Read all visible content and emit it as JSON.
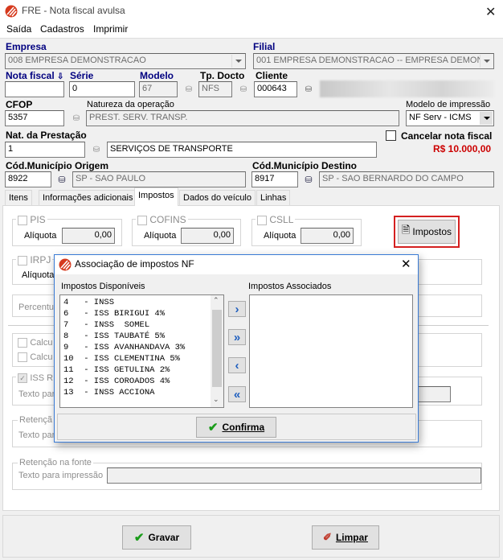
{
  "window": {
    "title": "FRE - Nota fiscal avulsa"
  },
  "menu": [
    "Saída",
    "Cadastros",
    "Imprimir"
  ],
  "form": {
    "empresa_label": "Empresa",
    "empresa_value": "008 EMPRESA DEMONSTRACAO",
    "filial_label": "Filial",
    "filial_value": "001 EMPRESA DEMONSTRACAO -- EMPRESA DEMONS",
    "nota_label": "Nota fiscal",
    "nota_value": "",
    "serie_label": "Série",
    "serie_value": "0",
    "modelo_label": "Modelo",
    "modelo_value": "67",
    "tpdocto_label": "Tp. Docto",
    "tpdocto_value": "NFS",
    "cliente_label": "Cliente",
    "cliente_value": "000643",
    "cfop_label": "CFOP",
    "cfop_value": "5357",
    "natureza_label": "Natureza da operação",
    "natureza_value": "PREST. SERV. TRANSP.",
    "modelo_imp_label": "Modelo de impressão",
    "modelo_imp_value": "NF Serv - ICMS",
    "natprest_label": "Nat. da Prestação",
    "natprest_code": "1",
    "natprest_desc": "SERVIÇOS DE TRANSPORTE",
    "cancelar_label": "Cancelar nota fiscal",
    "valor_total": "R$ 10.000,00",
    "origem_label": "Cód.Município Origem",
    "origem_code": "8922",
    "origem_desc": "SP - SAO PAULO",
    "destino_label": "Cód.Município Destino",
    "destino_code": "8917",
    "destino_desc": "SP - SAO BERNARDO DO CAMPO"
  },
  "tabs": [
    "Itens",
    "Informações adicionais",
    "Impostos",
    "Dados do veículo",
    "Linhas"
  ],
  "impostos": {
    "pis": "PIS",
    "cofins": "COFINS",
    "csll": "CSLL",
    "aliquota": "Alíquota",
    "zero": "0,00",
    "impostos_button": "Impostos",
    "irpj": "IRPJ",
    "aliquota_short": "Alíquota",
    "percentual": "Percentu",
    "calc1": "Calcu",
    "calc2": "Calcu",
    "iss": "ISS R",
    "texto1": "Texto par",
    "retencao1": "Retençã",
    "texto2": "Texto par",
    "retencao_fonte": "Retenção na fonte",
    "texto_impressao": "Texto para impressão"
  },
  "dialog": {
    "title": "Associação de impostos NF",
    "disponiveis_label": "Impostos Disponíveis",
    "associados_label": "Impostos Associados",
    "items": [
      "4   - INSS",
      "6   - ISS BIRIGUI 4%",
      "7   - INSS  SOMEL",
      "8   - ISS TAUBATÉ 5%",
      "9   - ISS AVANHANDAVA 3%",
      "10  - ISS CLEMENTINA 5%",
      "11  - ISS GETULINA 2%",
      "12  - ISS COROADOS 4%",
      "13  - INSS ACCIONA"
    ],
    "btn_add": "›",
    "btn_add_all": "»",
    "btn_remove": "‹",
    "btn_remove_all": "«",
    "confirma": "Confirma"
  },
  "footer": {
    "gravar": "Gravar",
    "limpar": "Limpar"
  },
  "colors": {
    "accent_red": "#cc0000",
    "label_blue": "#000080",
    "highlight": "#d42020"
  }
}
